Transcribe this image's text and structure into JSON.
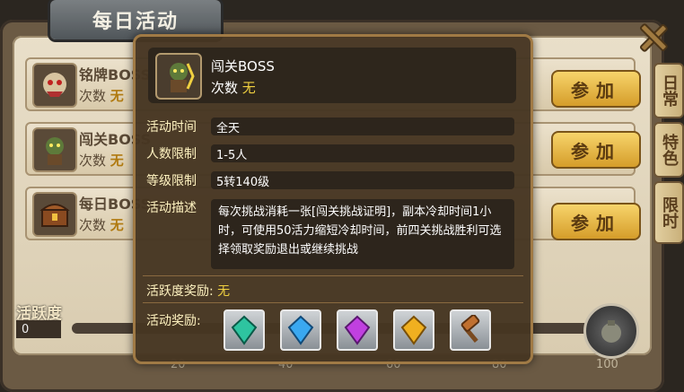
{
  "title": "每日活动",
  "side_tabs": [
    "日常",
    "特色",
    "限时"
  ],
  "rows": [
    {
      "name": "铭牌BOSS",
      "count_label": "次数",
      "count_value": "无",
      "join_label": "参加"
    },
    {
      "name": "闯关BOSS",
      "count_label": "次数",
      "count_value": "无",
      "join_label": "参加"
    },
    {
      "name": "每日BOSS",
      "count_label": "次数",
      "count_value": "无",
      "join_label": "参加"
    }
  ],
  "activity": {
    "label": "活跃度",
    "value": "0",
    "milestones": [
      "20",
      "40",
      "60",
      "80",
      "100"
    ]
  },
  "popup": {
    "title": "闯关BOSS",
    "count_label": "次数",
    "count_value": "无",
    "time_label": "活动时间",
    "time_value": "全天",
    "people_label": "人数限制",
    "people_value": "1-5人",
    "level_label": "等级限制",
    "level_value": "5转140级",
    "desc_label": "活动描述",
    "desc_value": "每次挑战消耗一张[闯关挑战证明]，副本冷却时间1小时，可使用50活力缩短冷却时间，前四关挑战胜利可选择领取奖励退出或继续挑战",
    "activity_reward_label": "活跃度奖励:",
    "activity_reward_value": "无",
    "reward_label": "活动奖励:",
    "rewards": [
      {
        "icon": "green-gem-icon",
        "color": "#2ec4a0"
      },
      {
        "icon": "blue-gem-icon",
        "color": "#3aa8f0"
      },
      {
        "icon": "purple-gem-icon",
        "color": "#c040e0"
      },
      {
        "icon": "gold-gem-icon",
        "color": "#f0b020"
      },
      {
        "icon": "hammer-icon",
        "color": "#c07030"
      }
    ]
  }
}
